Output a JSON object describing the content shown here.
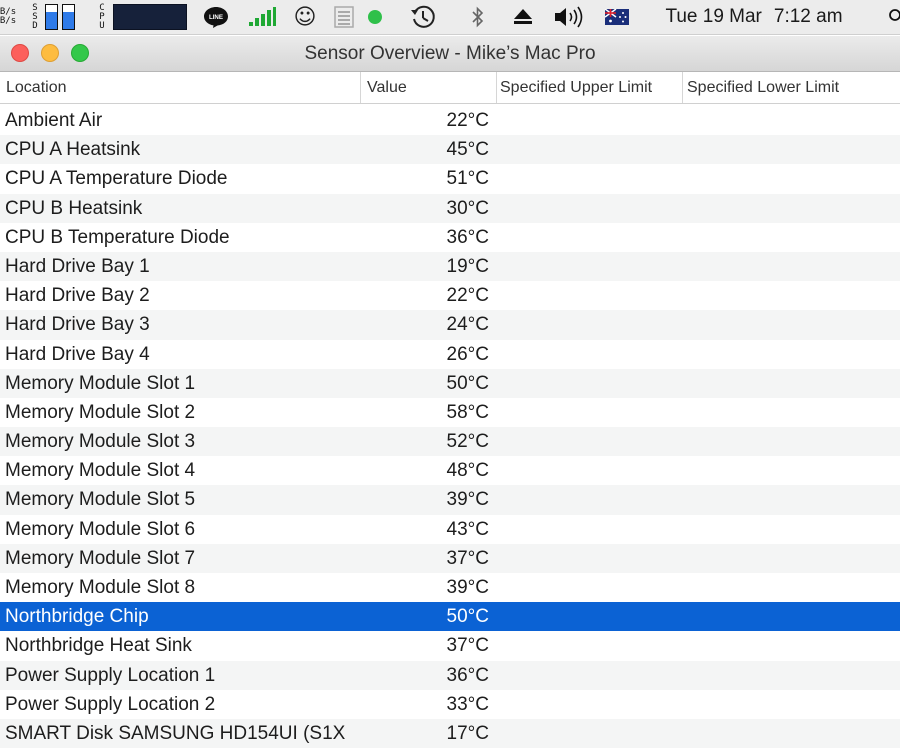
{
  "menubar": {
    "net_up": "B/s",
    "net_down": "B/s",
    "ssd_label": [
      "S",
      "S",
      "D"
    ],
    "ssd_usage": [
      0.7,
      0.7
    ],
    "cpu_label": [
      "C",
      "P",
      "U"
    ],
    "line_icon_text": "LINE",
    "clock_day": "Tue 19 Mar",
    "clock_time": "7:12 am"
  },
  "window": {
    "title": "Sensor Overview - Mike’s Mac Pro"
  },
  "table": {
    "columns": [
      "Location",
      "Value",
      "Specified Upper Limit",
      "Specified Lower Limit"
    ],
    "rows": [
      {
        "location": "Ambient Air",
        "value": "22°C"
      },
      {
        "location": "CPU A Heatsink",
        "value": "45°C"
      },
      {
        "location": "CPU A Temperature Diode",
        "value": "51°C"
      },
      {
        "location": "CPU B Heatsink",
        "value": "30°C"
      },
      {
        "location": "CPU B Temperature Diode",
        "value": "36°C"
      },
      {
        "location": "Hard Drive Bay 1",
        "value": "19°C"
      },
      {
        "location": "Hard Drive Bay 2",
        "value": "22°C"
      },
      {
        "location": "Hard Drive Bay 3",
        "value": "24°C"
      },
      {
        "location": "Hard Drive Bay 4",
        "value": "26°C"
      },
      {
        "location": "Memory Module Slot 1",
        "value": "50°C"
      },
      {
        "location": "Memory Module Slot 2",
        "value": "58°C"
      },
      {
        "location": "Memory Module Slot 3",
        "value": "52°C"
      },
      {
        "location": "Memory Module Slot 4",
        "value": "48°C"
      },
      {
        "location": "Memory Module Slot 5",
        "value": "39°C"
      },
      {
        "location": "Memory Module Slot 6",
        "value": "43°C"
      },
      {
        "location": "Memory Module Slot 7",
        "value": "37°C"
      },
      {
        "location": "Memory Module Slot 8",
        "value": "39°C"
      },
      {
        "location": "Northbridge Chip",
        "value": "50°C",
        "selected": true
      },
      {
        "location": "Northbridge Heat Sink",
        "value": "37°C"
      },
      {
        "location": "Power Supply Location 1",
        "value": "36°C"
      },
      {
        "location": "Power Supply Location 2",
        "value": "33°C"
      },
      {
        "location": "SMART Disk SAMSUNG HD154UI (S1X",
        "value": "17°C"
      }
    ]
  },
  "colors": {
    "selection": "#0b62d4",
    "close": "#fc605c",
    "minimize": "#fdbc40",
    "zoom": "#34c84a",
    "ssd_fill": "#2f7be9",
    "signal": "#1fa834",
    "status_dot": "#2fc04a"
  }
}
